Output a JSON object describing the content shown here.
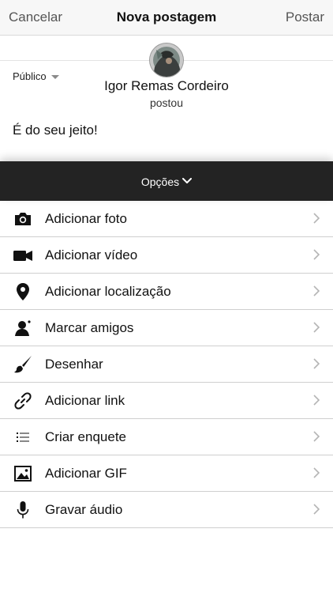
{
  "header": {
    "cancel_label": "Cancelar",
    "title": "Nova postagem",
    "post_label": "Postar"
  },
  "composer": {
    "privacy_label": "Público",
    "author_name": "Igor Remas Cordeiro",
    "author_action": "postou",
    "post_text": "É do seu jeito!"
  },
  "options": {
    "label": "Opções",
    "items": [
      {
        "label": "Adicionar foto",
        "icon": "camera-icon"
      },
      {
        "label": "Adicionar vídeo",
        "icon": "video-camera-icon"
      },
      {
        "label": "Adicionar localização",
        "icon": "location-pin-icon"
      },
      {
        "label": "Marcar amigos",
        "icon": "tag-person-icon"
      },
      {
        "label": "Desenhar",
        "icon": "paintbrush-icon"
      },
      {
        "label": "Adicionar link",
        "icon": "link-icon"
      },
      {
        "label": "Criar enquete",
        "icon": "poll-list-icon"
      },
      {
        "label": "Adicionar GIF",
        "icon": "gif-image-icon"
      },
      {
        "label": "Gravar áudio",
        "icon": "microphone-icon"
      }
    ]
  },
  "colors": {
    "options_bar": "#232323",
    "navbar_bg": "#f7f7f7",
    "nav_button_text": "#555555"
  }
}
